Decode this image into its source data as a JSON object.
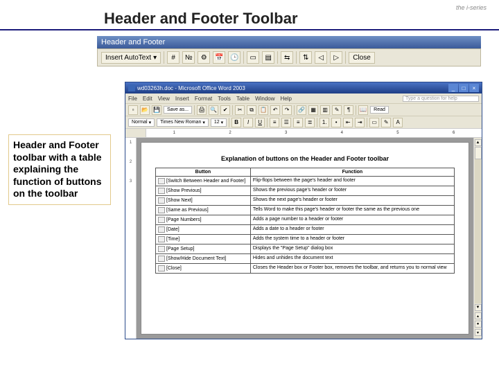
{
  "slide_title": "Header and Footer Toolbar",
  "brand": "the i-series",
  "caption": "Header and Footer toolbar with a table explaining the function of buttons on the toolbar",
  "hf_toolbar": {
    "title": "Header and Footer",
    "autotext": "Insert AutoText",
    "close": "Close"
  },
  "word": {
    "title": "wd03263h.doc - Microsoft Office Word 2003",
    "menus": [
      "File",
      "Edit",
      "View",
      "Insert",
      "Format",
      "Tools",
      "Table",
      "Window",
      "Help"
    ],
    "help_placeholder": "Type a question for help",
    "save_as": "Save as...",
    "read": "Read",
    "font_name": "Times New Roman",
    "font_size": "12",
    "style": "Normal",
    "ruler_marks": [
      "1",
      "2",
      "3",
      "4",
      "5",
      "6"
    ],
    "vruler_marks": [
      "1",
      "2",
      "3"
    ],
    "doc_heading": "Explanation of buttons on the Header and Footer toolbar",
    "th_button": "Button",
    "th_function": "Function",
    "rows": [
      {
        "label": "[Switch Between Header and Footer]",
        "func": "Flip-flops between the page's header and footer"
      },
      {
        "label": "[Show Previous]",
        "func": "Shows the previous page's header or footer"
      },
      {
        "label": "[Show Next]",
        "func": "Shows the next page's header or footer"
      },
      {
        "label": "[Same as Previous]",
        "func": "Tells Word to make this page's header or footer the same as the previous one"
      },
      {
        "label": "[Page Numbers]",
        "func": "Adds a page number to a header or footer"
      },
      {
        "label": "[Date]",
        "func": "Adds a date to a header or footer"
      },
      {
        "label": "[Time]",
        "func": "Adds the system time to a header or footer"
      },
      {
        "label": "[Page Setup]",
        "func": "Displays the \"Page Setup\" dialog box"
      },
      {
        "label": "[Show/Hide Document Text]",
        "func": "Hides and unhides the document text"
      },
      {
        "label": "[Close]",
        "func": "Closes the Header box or Footer box, removes the toolbar, and returns you to normal view"
      }
    ]
  }
}
